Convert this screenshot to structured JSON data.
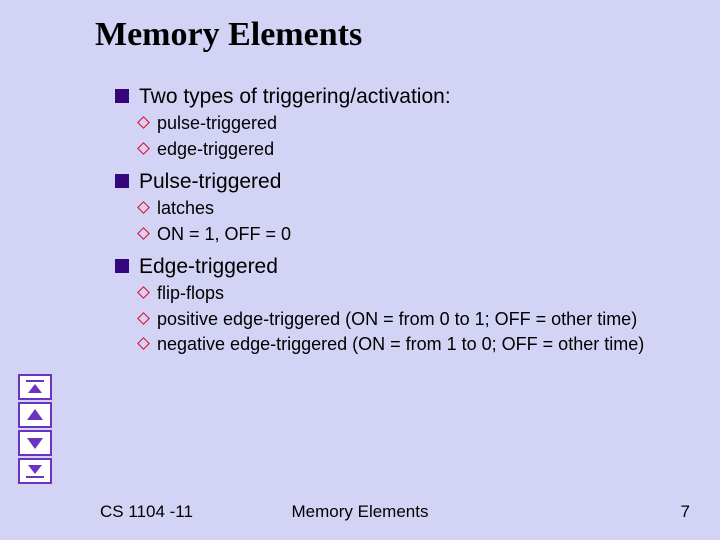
{
  "title": "Memory Elements",
  "bullets": [
    {
      "text": "Two types of triggering/activation:",
      "sub": [
        "pulse-triggered",
        "edge-triggered"
      ]
    },
    {
      "text": "Pulse-triggered",
      "sub": [
        "latches",
        "ON = 1, OFF = 0"
      ]
    },
    {
      "text": "Edge-triggered",
      "sub": [
        "flip-flops",
        "positive edge-triggered (ON = from 0 to 1; OFF = other time)",
        "negative edge-triggered (ON = from 1 to 0; OFF = other time)"
      ]
    }
  ],
  "nav_icons": [
    "first",
    "prev",
    "next",
    "last"
  ],
  "footer": {
    "left": "CS 1104 -11",
    "center": "Memory Elements",
    "right": "7"
  },
  "colors": {
    "background": "#d3d4f5",
    "square_bullet": "#36077a",
    "diamond_outline": "#e40025",
    "nav_border": "#6a34c3"
  }
}
